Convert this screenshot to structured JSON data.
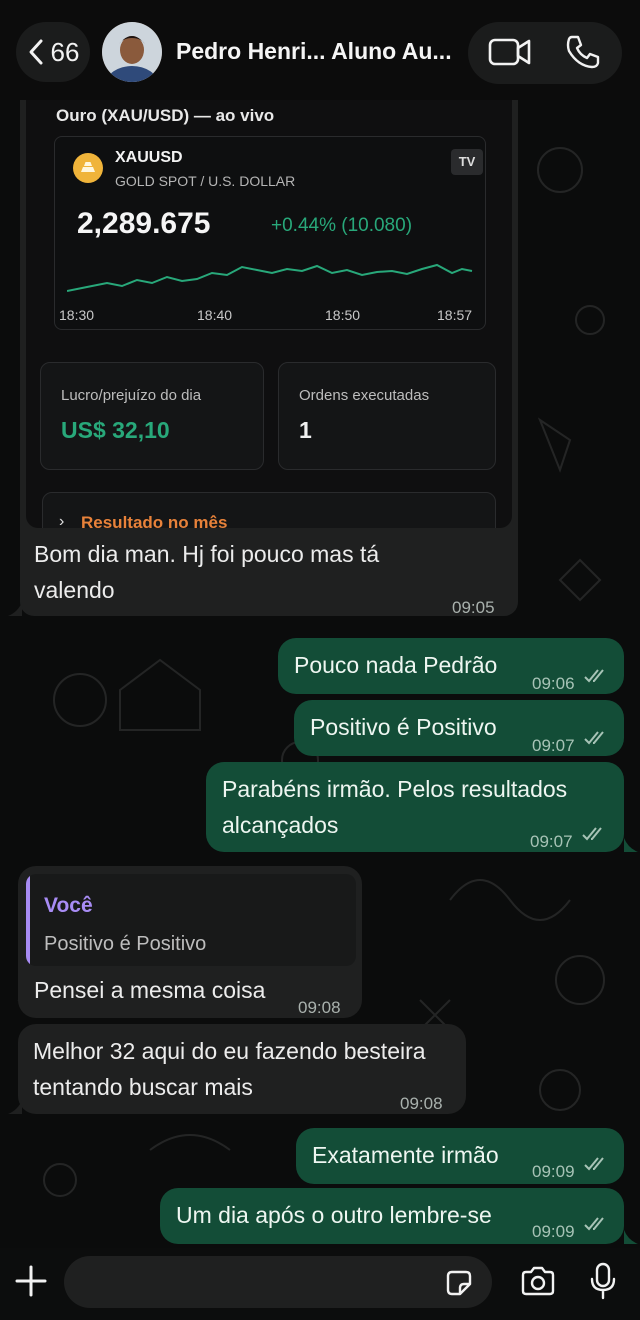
{
  "header": {
    "back_count": "66",
    "contact_name": "Pedro Henri... Aluno Au..."
  },
  "shared_image": {
    "title": "Ouro (XAU/USD) — ao vivo",
    "symbol": "XAUUSD",
    "symbol_desc": "GOLD SPOT / U.S. DOLLAR",
    "tv_logo": "TV",
    "price": "2,289.675",
    "change": "+0.44% (10.080)",
    "x_ticks": [
      "18:30",
      "18:40",
      "18:50",
      "18:57"
    ],
    "stat_pl_label": "Lucro/prejuízo do dia",
    "stat_pl_value": "US$ 32,10",
    "stat_orders_label": "Ordens executadas",
    "stat_orders_value": "1",
    "month_result_label": "Resultado no mês",
    "colors": {
      "positive": "#28a87a",
      "accent_orange": "#e8823a",
      "gold": "#f0b43a"
    }
  },
  "messages": [
    {
      "dir": "in",
      "text": [
        "Bom dia man. Hj foi pouco mas tá",
        "valendo"
      ],
      "time": "09:05"
    },
    {
      "dir": "out",
      "text": [
        "Pouco nada Pedrão"
      ],
      "time": "09:06"
    },
    {
      "dir": "out",
      "text": [
        "Positivo é Positivo"
      ],
      "time": "09:07"
    },
    {
      "dir": "out",
      "text": [
        "Parabéns irmão. Pelos resultados",
        "alcançados"
      ],
      "time": "09:07"
    },
    {
      "dir": "in",
      "quote_author": "Você",
      "quote_text": "Positivo é Positivo",
      "text": [
        "Pensei a mesma coisa"
      ],
      "time": "09:08"
    },
    {
      "dir": "in",
      "text": [
        "Melhor 32 aqui do eu fazendo besteira",
        "tentando buscar mais"
      ],
      "time": "09:08"
    },
    {
      "dir": "out",
      "text": [
        "Exatamente irmão"
      ],
      "time": "09:09"
    },
    {
      "dir": "out",
      "text": [
        "Um dia após o outro lembre-se"
      ],
      "time": "09:09"
    }
  ],
  "composer": {
    "input_value": ""
  },
  "colors": {
    "outgoing_bubble": "#134d37",
    "incoming_bubble": "#1f2020",
    "quote_accent": "#a88cf4"
  }
}
